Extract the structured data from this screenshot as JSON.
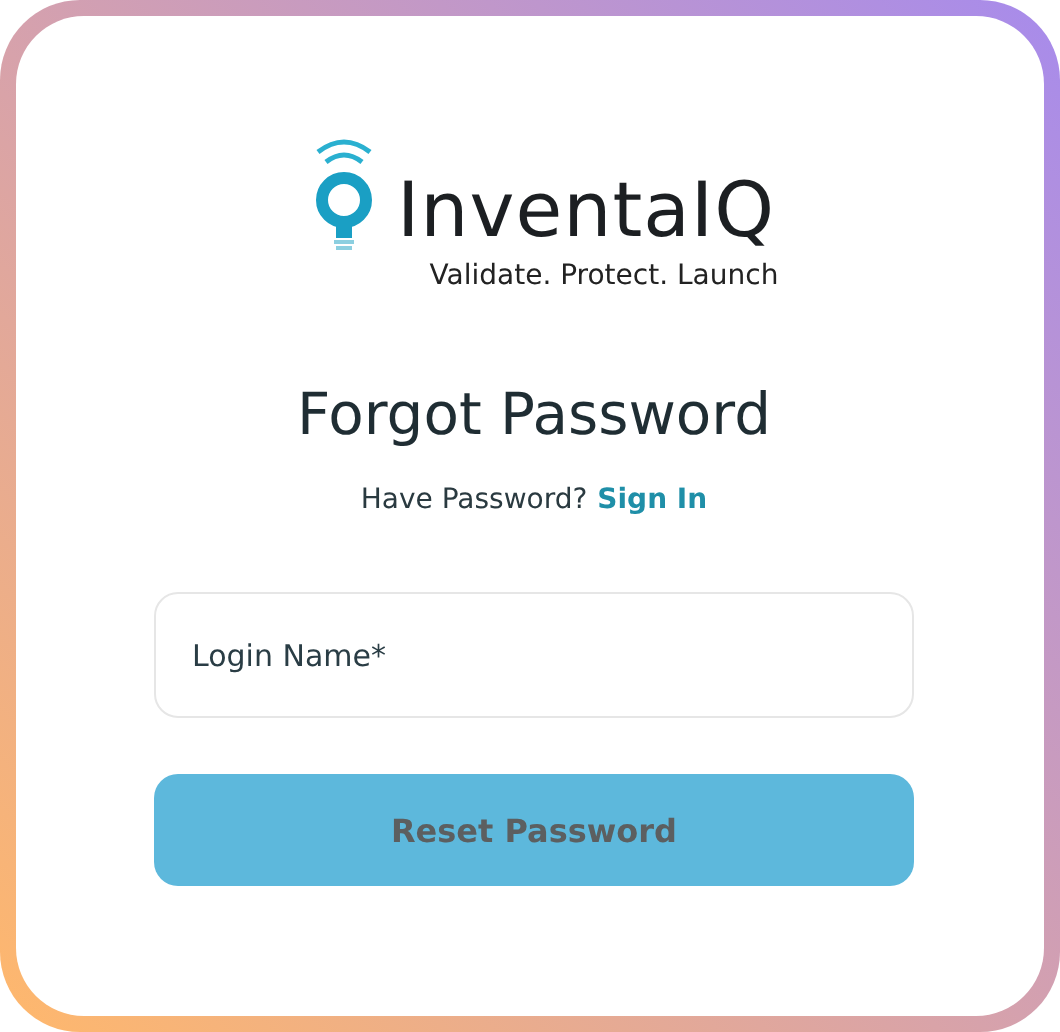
{
  "logo": {
    "name": "InventaIQ",
    "tagline": "Validate. Protect. Launch"
  },
  "title": "Forgot Password",
  "prompt": {
    "text": "Have Password?",
    "link": "Sign In"
  },
  "field": {
    "placeholder": "Login Name*"
  },
  "button": {
    "label": "Reset Password",
    "disabled": true
  }
}
